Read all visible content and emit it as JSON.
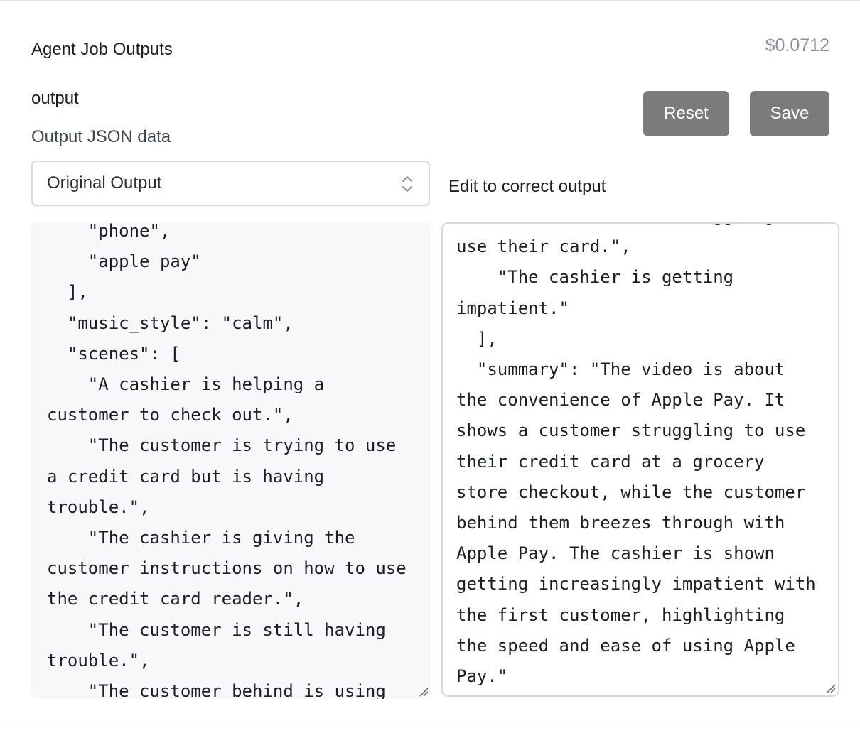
{
  "header": {
    "title": "Agent Job Outputs",
    "cost": "$0.0712"
  },
  "field": {
    "label": "output",
    "description": "Output JSON data"
  },
  "buttons": {
    "reset_label": "Reset",
    "save_label": "Save"
  },
  "select": {
    "value": "Original Output"
  },
  "editor": {
    "label": "Edit to correct output"
  },
  "original_output_text": "    \"phone\",\n    \"apple pay\"\n  ],\n  \"music_style\": \"calm\",\n  \"scenes\": [\n    \"A cashier is helping a customer to check out.\",\n    \"The customer is trying to use a credit card but is having trouble.\",\n    \"The cashier is giving the customer instructions on how to use the credit card reader.\",\n    \"The customer is still having trouble.\",\n    \"The customer behind is using",
  "edited_output_text": "    \"The customer is struggling to use their card.\",\n    \"The cashier is getting impatient.\"\n  ],\n  \"summary\": \"The video is about the convenience of Apple Pay. It shows a customer struggling to use their credit card at a grocery store checkout, while the customer behind them breezes through with Apple Pay. The cashier is shown getting increasingly impatient with the first customer, highlighting the speed and ease of using Apple Pay.\"\n}"
}
